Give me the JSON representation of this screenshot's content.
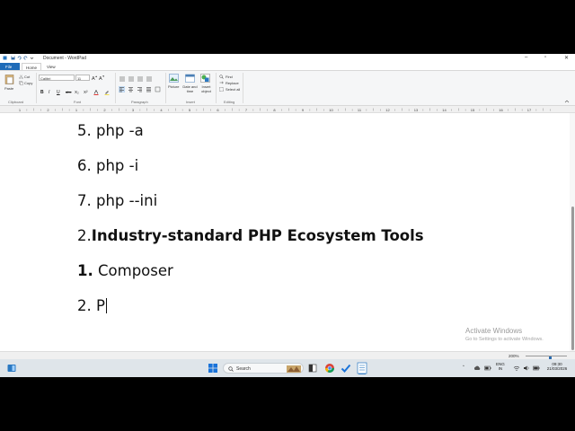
{
  "window": {
    "title": "Document - WordPad",
    "controls": [
      "minimize-icon",
      "maximize-icon",
      "close-icon"
    ]
  },
  "ribbon_tabs": [
    "File",
    "Home",
    "View"
  ],
  "ribbon": {
    "clipboard": {
      "label": "Clipboard",
      "paste": "Paste",
      "cut": "Cut",
      "copy": "Copy"
    },
    "font": {
      "label": "Font",
      "family": "Calibri",
      "size": "11",
      "buttons": [
        "B",
        "I",
        "U",
        "abc",
        "X₂",
        "X²"
      ]
    },
    "paragraph": {
      "label": "Paragraph"
    },
    "insert": {
      "label": "Insert",
      "picture": "Picture",
      "datetime": "Date and time",
      "object": "Insert object"
    },
    "editing": {
      "label": "Editing",
      "find": "Find",
      "replace": "Replace",
      "select_all": "Select all"
    }
  },
  "ruler": {
    "labels": [
      "1",
      "2",
      "1",
      "2",
      "3",
      "4",
      "5",
      "6",
      "7",
      "8",
      "9",
      "10",
      "11",
      "12",
      "13",
      "14",
      "15",
      "16",
      "17"
    ]
  },
  "document": {
    "lines": [
      {
        "prefix": "5.",
        "text": "php -a"
      },
      {
        "prefix": "6.",
        "text": "php -i"
      },
      {
        "prefix": "7.",
        "text": "php --ini"
      },
      {
        "prefix": "2.",
        "text": "Industry-standard PHP Ecosystem Tools"
      },
      {
        "prefix": "1.",
        "text": "Composer"
      },
      {
        "prefix": "2.",
        "text": "P"
      }
    ]
  },
  "activation": {
    "title": "Activate Windows",
    "subtitle": "Go to Settings to activate Windows."
  },
  "statusbar": {
    "zoom": "200%",
    "zoom_fraction": 0.6
  },
  "taskbar": {
    "search_placeholder": "Search",
    "language": "ENG",
    "region": "IN",
    "time": "09:30",
    "date": "21/03/2026"
  }
}
